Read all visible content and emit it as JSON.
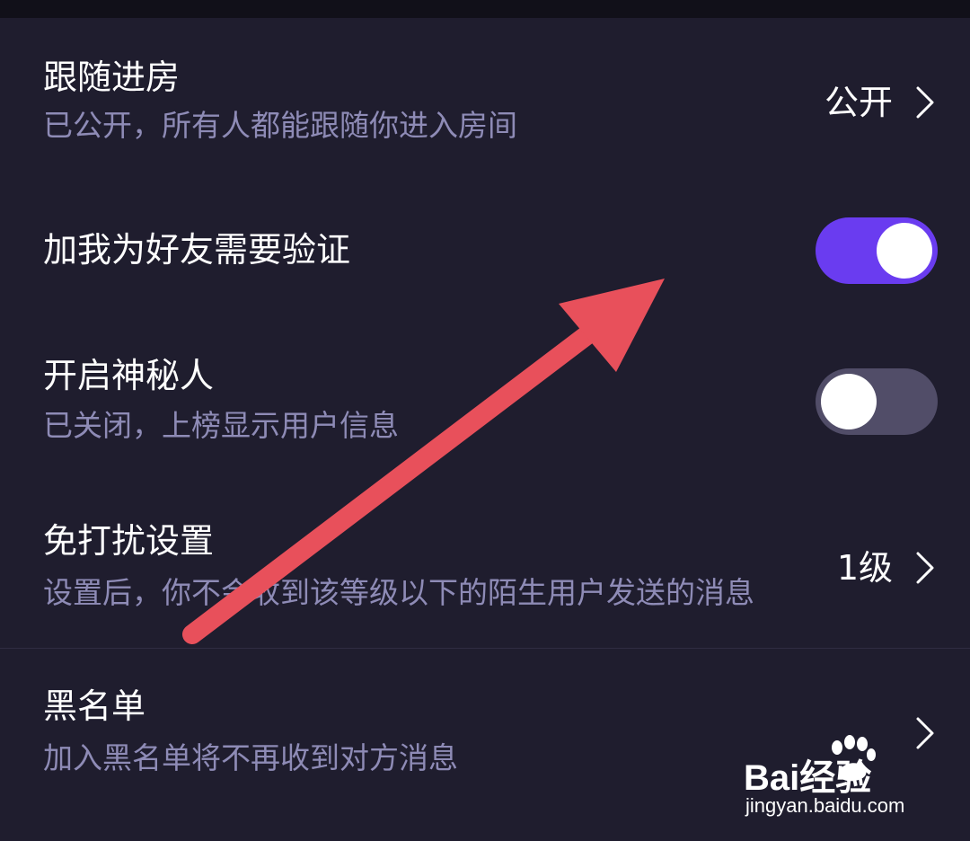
{
  "settings": {
    "follow_room": {
      "title": "跟随进房",
      "subtitle": "已公开，所有人都能跟随你进入房间",
      "value": "公开"
    },
    "friend_verify": {
      "title": "加我为好友需要验证",
      "toggle_on": true
    },
    "mystery_man": {
      "title": "开启神秘人",
      "subtitle": "已关闭，上榜显示用户信息",
      "toggle_on": false
    },
    "do_not_disturb": {
      "title": "免打扰设置",
      "subtitle": "设置后，你不会收到该等级以下的陌生用户发送的消息",
      "value": "1级"
    },
    "blacklist": {
      "title": "黑名单",
      "subtitle": "加入黑名单将不再收到对方消息"
    }
  },
  "watermark": {
    "logo_text": "Bai经验",
    "url": "jingyan.baidu.com"
  },
  "colors": {
    "background": "#1f1d2e",
    "toggle_on": "#6a3cf0",
    "toggle_off": "#514d68",
    "subtitle": "#8e8bb6",
    "annotation_arrow": "#e8505b"
  },
  "icons": {
    "row_chevron": "chevron-right-icon",
    "annotation": "red-arrow-annotation"
  }
}
